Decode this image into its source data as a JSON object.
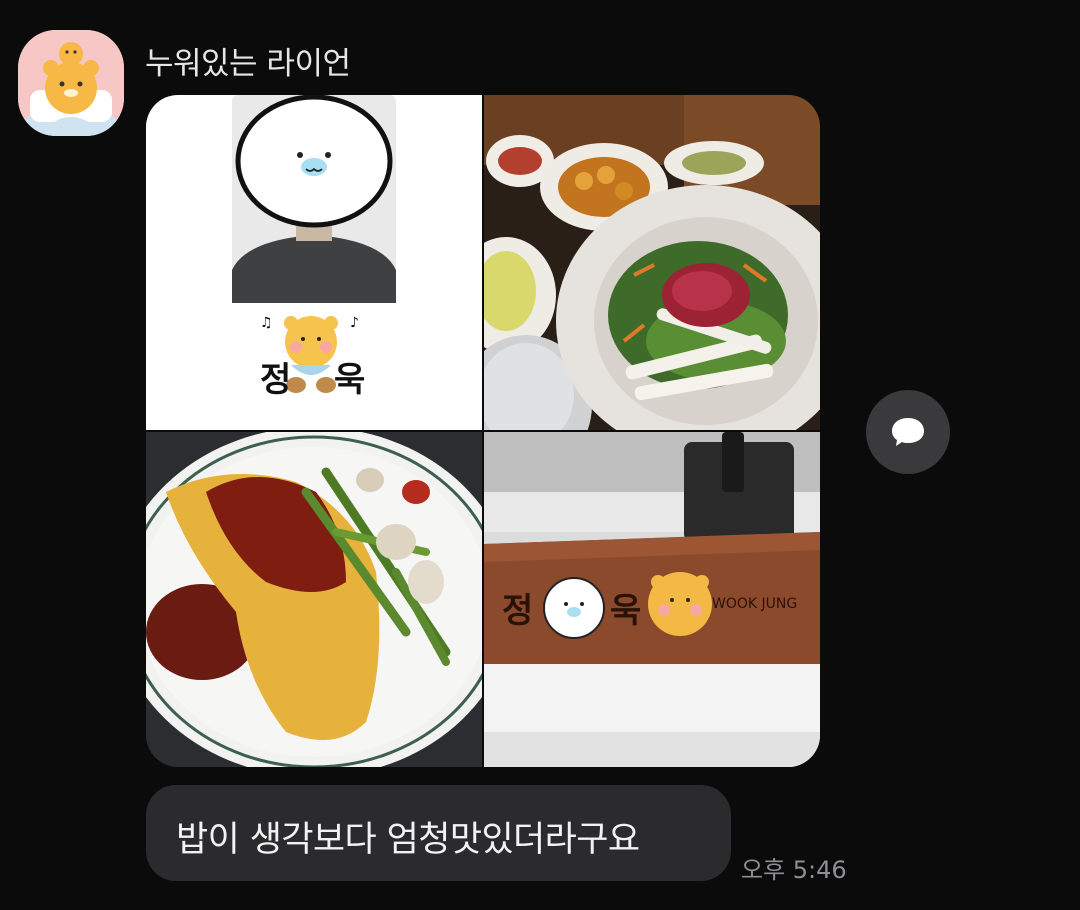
{
  "chat": {
    "sender": {
      "name": "누워있는 라이언",
      "avatar_icon": "lion-character-avatar-icon",
      "avatar_bg": "#f6c7c4"
    },
    "photos": [
      {
        "label": "정욱",
        "name_icon": "lion-character-icon"
      },
      {
        "description_icon": "food-bowl-icon"
      },
      {
        "description_icon": "omelette-plate-icon"
      },
      {
        "label_korean": "정욱",
        "label_english": "WOOK JUNG"
      }
    ],
    "message": {
      "text": "밥이 생각보다 엄청맛있더라구요",
      "time": "오후 5:46"
    },
    "share_icon": "speech-bubble-icon"
  },
  "colors": {
    "background": "#0b0b0c",
    "bubble": "#2b2b2d",
    "share_button": "#3a3a3c",
    "timestamp": "#8f8f93"
  }
}
